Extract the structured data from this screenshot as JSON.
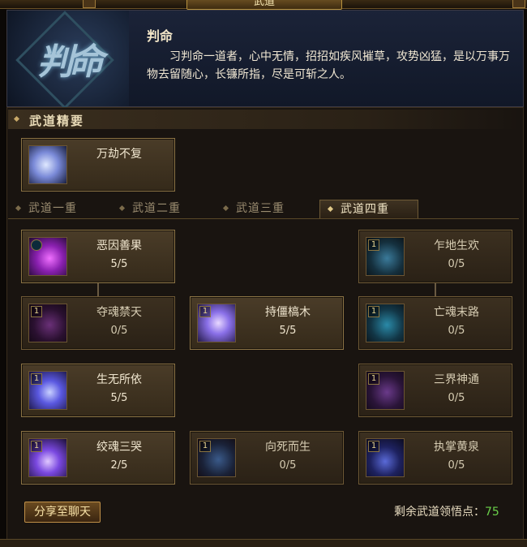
{
  "window": {
    "title": "武道"
  },
  "header": {
    "emblem_text": "判命",
    "name": "判命",
    "description": "习判命一道者，心中无情，招招如疾风摧草，攻势凶猛，是以万事万物去留随心，长镰所指，尽是可斩之人。"
  },
  "essence": {
    "title": "武道精要",
    "skill": {
      "name": "万劫不复",
      "icon": "ice-swirl-icon"
    }
  },
  "tabs": [
    {
      "label": "武道一重"
    },
    {
      "label": "武道二重"
    },
    {
      "label": "武道三重"
    },
    {
      "label": "武道四重",
      "selected": true
    }
  ],
  "skills": {
    "left": [
      {
        "name": "恶因善果",
        "level": "5/5",
        "icon": "magenta-ghost-icon",
        "active": true
      },
      {
        "name": "夺魂禁天",
        "level": "0/5",
        "icon": "purple-reaper-icon",
        "active": false
      },
      {
        "name": "生无所依",
        "level": "5/5",
        "icon": "blue-slash-icon",
        "active": true
      },
      {
        "name": "绞魂三哭",
        "level": "2/5",
        "icon": "violet-slash-icon",
        "active": true
      }
    ],
    "middle": [
      {
        "name": "持僵槁木",
        "level": "5/5",
        "icon": "spirit-aura-icon",
        "active": true
      },
      {
        "name": "向死而生",
        "level": "0/5",
        "icon": "dark-rune-icon",
        "active": false
      }
    ],
    "right": [
      {
        "name": "乍地生欢",
        "level": "0/5",
        "icon": "cyan-ghost-icon",
        "active": false
      },
      {
        "name": "亡魂末路",
        "level": "0/5",
        "icon": "teal-ghost-icon",
        "active": false
      },
      {
        "name": "三界神通",
        "level": "0/5",
        "icon": "purple-vortex-icon",
        "active": false
      },
      {
        "name": "执掌黄泉",
        "level": "0/5",
        "icon": "blue-wave-icon",
        "active": false
      }
    ]
  },
  "rank_badge": "1",
  "footer": {
    "share_label": "分享至聊天",
    "points_label": "剩余武道领悟点：",
    "points_value": "75"
  }
}
